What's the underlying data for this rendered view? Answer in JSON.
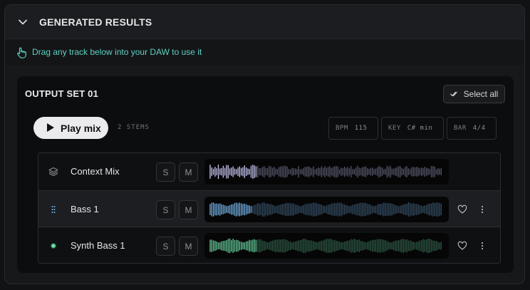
{
  "header": {
    "title": "GENERATED RESULTS",
    "collapse_icon": "chevron-down-icon"
  },
  "hint": {
    "icon": "hand-pointer-icon",
    "text": "Drag any track below into your DAW to use it",
    "color": "#5fd1c2"
  },
  "output_set": {
    "title": "OUTPUT SET 01",
    "select_all_label": "Select all",
    "play_mix_label": "Play mix",
    "stems_label": "2 STEMS",
    "meta": [
      {
        "key": "BPM",
        "value": "115"
      },
      {
        "key": "KEY",
        "value": "C# min"
      },
      {
        "key": "BAR",
        "value": "4/4"
      }
    ]
  },
  "tracks": [
    {
      "name": "Context Mix",
      "icon": "layers-icon",
      "solo": "S",
      "mute": "M",
      "wave_color": "#c8c6f2",
      "progress": 0.2,
      "actions": false
    },
    {
      "name": "Bass 1",
      "icon": "drag-handle-icon",
      "solo": "S",
      "mute": "M",
      "wave_color": "#76b4e8",
      "progress": 0.18,
      "actions": true
    },
    {
      "name": "Synth Bass 1",
      "icon": "status-dot-icon",
      "solo": "S",
      "mute": "M",
      "wave_color": "#69d29f",
      "progress": 0.2,
      "actions": true
    }
  ]
}
